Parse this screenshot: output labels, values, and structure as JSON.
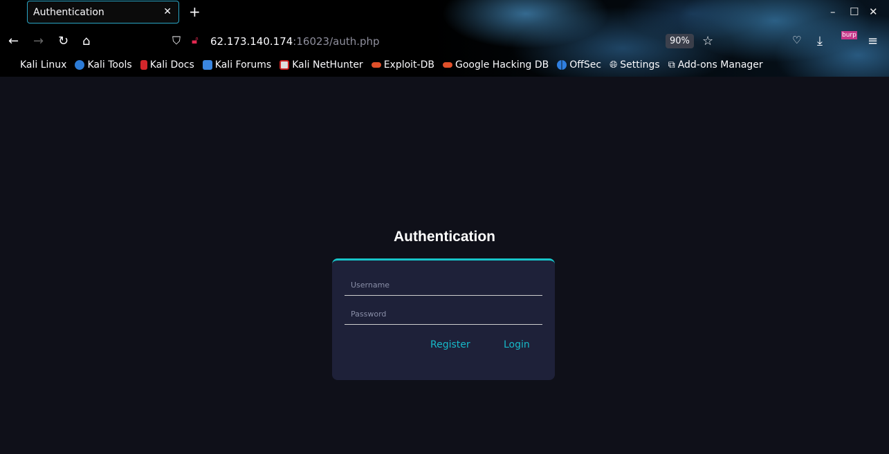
{
  "browser": {
    "tab_title": "Authentication",
    "url_host": "62.173.140.174",
    "url_rest": ":16023/auth.php",
    "zoom": "90%",
    "extension_badge": "burp",
    "bookmarks": [
      "Kali Linux",
      "Kali Tools",
      "Kali Docs",
      "Kali Forums",
      "Kali NetHunter",
      "Exploit-DB",
      "Google Hacking DB",
      "OffSec",
      "Settings",
      "Add-ons Manager"
    ]
  },
  "page": {
    "title": "Authentication",
    "username_placeholder": "Username",
    "password_placeholder": "Password",
    "register_label": "Register",
    "login_label": "Login",
    "accent": "#17c4c9"
  }
}
